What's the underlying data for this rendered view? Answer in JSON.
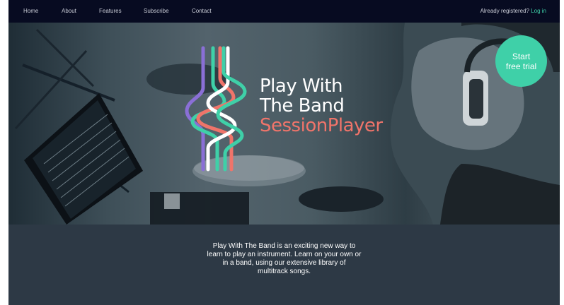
{
  "nav": {
    "items": [
      {
        "label": "Home"
      },
      {
        "label": "About"
      },
      {
        "label": "Features"
      },
      {
        "label": "Subscribe"
      },
      {
        "label": "Contact"
      }
    ],
    "already_registered": "Already registered?",
    "login": "Log in"
  },
  "hero": {
    "title_line1": "Play With",
    "title_line2": "The Band",
    "title_line3": "SessionPlayer",
    "cta_line1": "Start",
    "cta_line2": "free trial"
  },
  "description": {
    "lines": [
      "Play With The Band is an exciting new way to",
      "learn to play an instrument. Learn on your own or",
      "in a band, using our extensive library of",
      "multitrack songs."
    ]
  },
  "colors": {
    "nav_bg": "#070b21",
    "accent_green": "#3fd0a8",
    "accent_coral": "#f0746a",
    "logo_purple": "#8a6fd6",
    "body_bg": "#2d3945"
  },
  "icons": {
    "logo": "waveform-logo-icon"
  }
}
